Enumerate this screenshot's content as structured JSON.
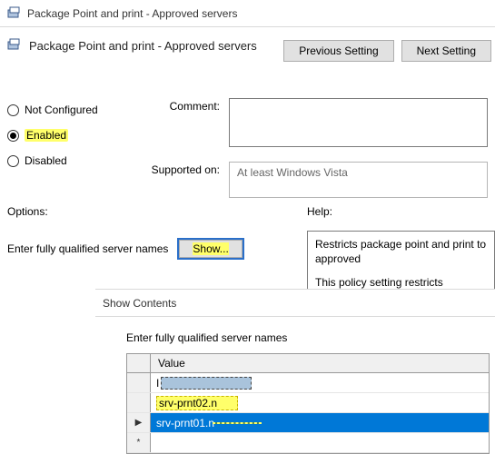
{
  "window": {
    "title": "Package Point and print - Approved servers"
  },
  "header": {
    "title": "Package Point and print - Approved servers"
  },
  "nav": {
    "prev": "Previous Setting",
    "next": "Next Setting"
  },
  "state": {
    "not_configured": "Not Configured",
    "enabled": "Enabled",
    "disabled": "Disabled",
    "selected": "enabled"
  },
  "fields": {
    "comment_label": "Comment:",
    "comment_value": "",
    "supported_label": "Supported on:",
    "supported_value": "At least Windows Vista"
  },
  "sections": {
    "options": "Options:",
    "help": "Help:"
  },
  "options": {
    "label": "Enter fully qualified server names",
    "show_btn": "Show..."
  },
  "help": {
    "p1": "Restricts package point and print to approved",
    "p2": "This policy setting restricts package point and print to approved servers. This setting only applies"
  },
  "dialog": {
    "title": "Show Contents",
    "label": "Enter fully qualified server names",
    "col": "Value",
    "rows": [
      {
        "marker": "",
        "kind": "edit-redacted",
        "text": ""
      },
      {
        "marker": "",
        "kind": "hl",
        "text": "srv-prnt02.n"
      },
      {
        "marker": "▶",
        "kind": "selected",
        "text": "srv-prnt01.n"
      },
      {
        "marker": "*",
        "kind": "new",
        "text": ""
      }
    ]
  }
}
